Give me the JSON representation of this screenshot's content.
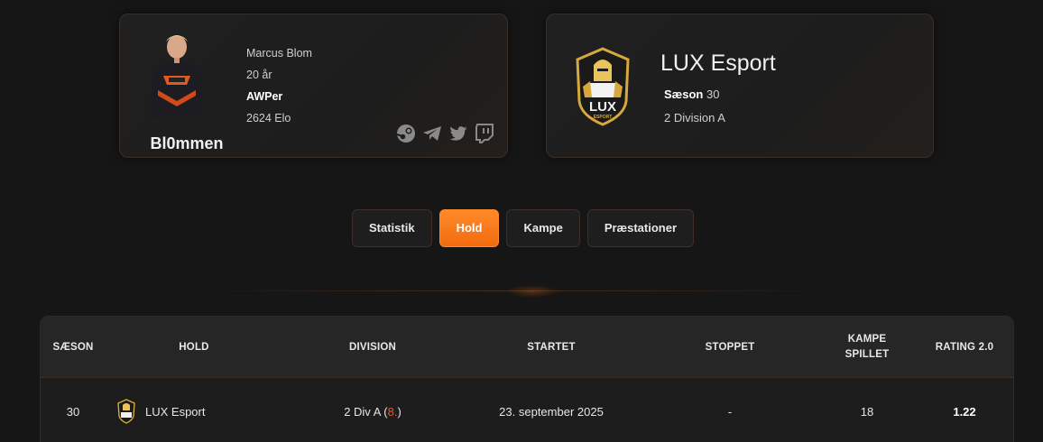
{
  "player": {
    "nickname": "Bl0mmen",
    "full_name": "Marcus Blom",
    "age": "20 år",
    "role": "AWPer",
    "elo": "2624 Elo",
    "socials": [
      "steam-icon",
      "telegram-icon",
      "twitter-icon",
      "twitch-icon"
    ]
  },
  "team": {
    "name": "LUX Esport",
    "season_label": "Sæson",
    "season_value": "30",
    "division": "2 Division A",
    "logo_text": "LUX",
    "logo_subtext": "ESPORT"
  },
  "tabs": [
    {
      "label": "Statistik",
      "active": false
    },
    {
      "label": "Hold",
      "active": true
    },
    {
      "label": "Kampe",
      "active": false
    },
    {
      "label": "Præstationer",
      "active": false
    }
  ],
  "table": {
    "headers": {
      "season": "SÆSON",
      "team": "HOLD",
      "division": "DIVISION",
      "started": "STARTET",
      "stopped": "STOPPET",
      "matches_1": "KAMPE",
      "matches_2": "SPILLET",
      "rating": "RATING 2.0"
    },
    "rows": [
      {
        "season": "30",
        "team": "LUX Esport",
        "division_text": "2 Div A (",
        "division_pos": "8.",
        "division_close": ")",
        "started": "23. september 2025",
        "stopped": "-",
        "matches": "18",
        "rating": "1.22"
      }
    ]
  },
  "colors": {
    "accent": "#f57a1c",
    "background": "#161616",
    "card": "#1f1f1f",
    "position": "#e05a3a"
  }
}
